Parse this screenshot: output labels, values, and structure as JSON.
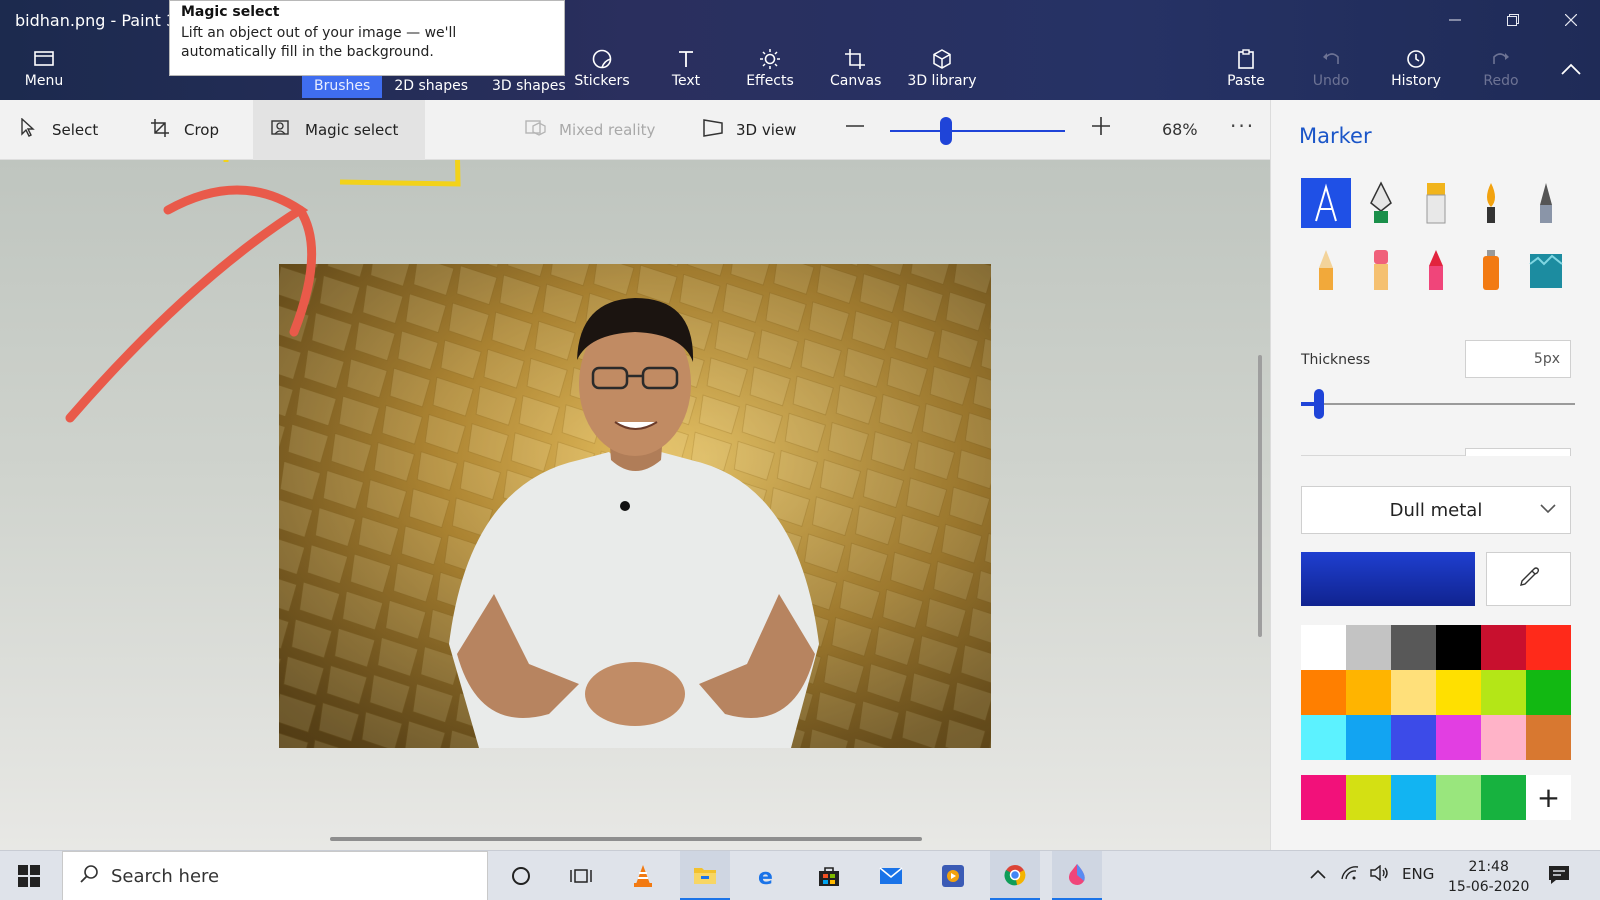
{
  "window": {
    "title": "bidhan.png - Paint 3D"
  },
  "tooltip": {
    "title": "Magic select",
    "body": "Lift an object out of your image — we'll automatically fill in the background."
  },
  "ribbon": {
    "menu": "Menu",
    "sub_tabs": [
      "Brushes",
      "2D shapes",
      "3D shapes"
    ],
    "items": [
      "Stickers",
      "Text",
      "Effects",
      "Canvas",
      "3D library"
    ],
    "paste": "Paste",
    "undo": "Undo",
    "history": "History",
    "redo": "Redo"
  },
  "toolbar": {
    "select": "Select",
    "crop": "Crop",
    "magic_select": "Magic select",
    "mixed_reality": "Mixed reality",
    "view3d": "3D view",
    "zoom_percent": "68%",
    "zoom_fraction": 0.32
  },
  "panel": {
    "title": "Marker",
    "thickness_label": "Thickness",
    "thickness_value": "5px",
    "thickness_fraction": 0.05,
    "material": "Dull metal",
    "current_color": "#1f3fd0",
    "brushes": [
      "marker",
      "calligraphy-pen",
      "oil-brush",
      "watercolor",
      "pixel-pen",
      "pencil",
      "eraser",
      "crayon",
      "spray-can",
      "fill"
    ],
    "palette": [
      "#ffffff",
      "#c3c3c3",
      "#585858",
      "#000000",
      "#c8102e",
      "#ff2a1a",
      "#ff7f00",
      "#ffb400",
      "#ffe07a",
      "#ffe000",
      "#b4e617",
      "#12b812",
      "#5cf2ff",
      "#12a4f2",
      "#3c4be8",
      "#e23ee2",
      "#ffb3c8",
      "#d87830"
    ],
    "custom_palette": [
      "#f2117a",
      "#d4e013",
      "#12b4f2",
      "#99e67d",
      "#17b23f"
    ]
  },
  "taskbar": {
    "search_placeholder": "Search here",
    "language": "ENG",
    "time": "21:48",
    "date": "15-06-2020"
  }
}
